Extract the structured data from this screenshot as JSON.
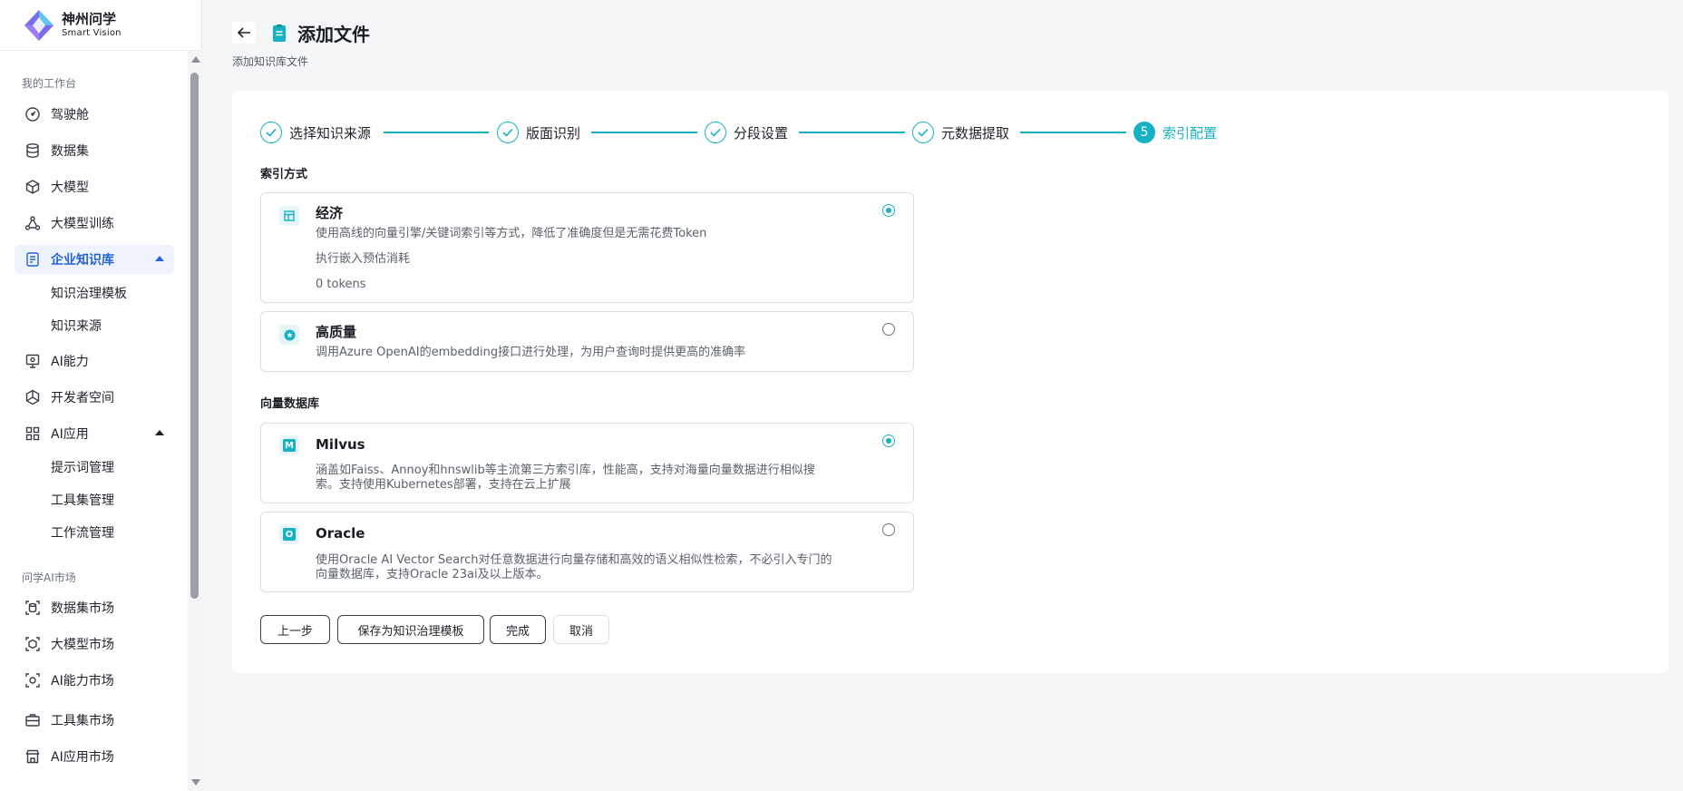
{
  "brand": {
    "name": "神州问学",
    "subtitle": "Smart Vision"
  },
  "sidebar": {
    "section1": "我的工作台",
    "items": [
      {
        "label": "驾驶舱",
        "icon": "gauge-icon"
      },
      {
        "label": "数据集",
        "icon": "database-icon"
      },
      {
        "label": "大模型",
        "icon": "cube-icon"
      },
      {
        "label": "大模型训练",
        "icon": "network-icon"
      },
      {
        "label": "企业知识库",
        "icon": "knowledge-icon",
        "active": true
      },
      {
        "label": "AI能力",
        "icon": "monitor-icon"
      },
      {
        "label": "开发者空间",
        "icon": "hexagon-icon"
      },
      {
        "label": "AI应用",
        "icon": "grid-icon"
      }
    ],
    "knowledge_sub": [
      "知识治理模板",
      "知识来源"
    ],
    "ai_app_sub": [
      "提示词管理",
      "工具集管理",
      "工作流管理"
    ],
    "section2": "问学AI市场",
    "market": [
      {
        "label": "数据集市场",
        "icon": "dataset-market-icon"
      },
      {
        "label": "大模型市场",
        "icon": "model-market-icon"
      },
      {
        "label": "AI能力市场",
        "icon": "ability-market-icon"
      },
      {
        "label": "工具集市场",
        "icon": "toolbox-icon"
      },
      {
        "label": "AI应用市场",
        "icon": "store-icon"
      }
    ]
  },
  "header": {
    "title": "添加文件",
    "subtitle": "添加知识库文件"
  },
  "steps": [
    {
      "label": "选择知识来源",
      "done": true
    },
    {
      "label": "版面识别",
      "done": true
    },
    {
      "label": "分段设置",
      "done": true
    },
    {
      "label": "元数据提取",
      "done": true
    },
    {
      "label": "索引配置",
      "number": "5",
      "current": true
    }
  ],
  "index_section": {
    "label": "索引方式",
    "economy": {
      "title": "经济",
      "desc": "使用高线的向量引擎/关键词索引等方式，降低了准确度但是无需花费Token",
      "cost_label": "执行嵌入预估消耗",
      "cost_value": "0 tokens",
      "selected": true
    },
    "quality": {
      "title": "高质量",
      "desc": "调用Azure OpenAI的embedding接口进行处理，为用户查询时提供更高的准确率",
      "selected": false
    }
  },
  "vector_section": {
    "label": "向量数据库",
    "milvus": {
      "title": "Milvus",
      "icon_letter": "M",
      "desc_line1": "涵盖如Faiss、Annoy和hnswlib等主流第三方索引库，性能高，支持对海量向量数据进行相似搜",
      "desc_line2": "索。支持使用Kubernetes部署，支持在云上扩展",
      "selected": true
    },
    "oracle": {
      "title": "Oracle",
      "icon_letter": "O",
      "desc_line1": "使用Oracle AI Vector Search对任意数据进行向量存储和高效的语义相似性检索，不必引入专门的",
      "desc_line2": "向量数据库，支持Oracle 23ai及以上版本。",
      "selected": false
    }
  },
  "buttons": {
    "prev": "上一步",
    "save_template": "保存为知识治理模板",
    "finish": "完成",
    "cancel": "取消"
  },
  "colors": {
    "accent": "#16b2c4",
    "active_nav": "#2563d6"
  }
}
